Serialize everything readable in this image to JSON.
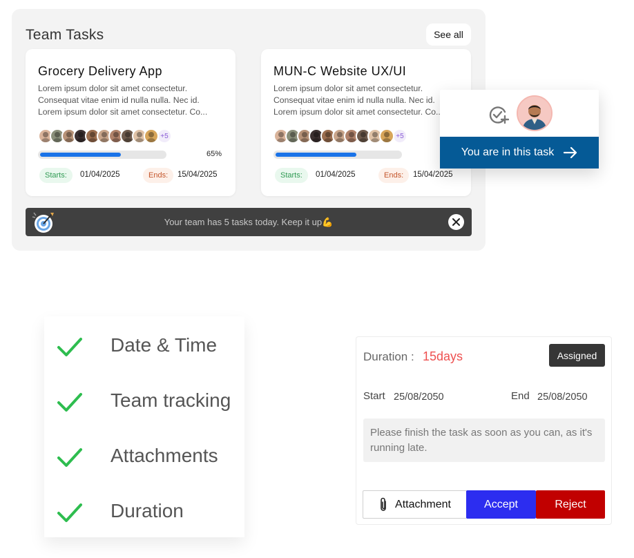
{
  "team_tasks": {
    "title": "Team Tasks",
    "see_all_label": "See all",
    "cards": [
      {
        "title": "Grocery Delivery App",
        "description": [
          "Lorem ipsum dolor sit amet consectetur.",
          "Consequat vitae enim id nulla nulla. Nec id.",
          "Lorem ipsum dolor sit amet consectetur. Co..."
        ],
        "members_extra": "+5",
        "progress_percent": 65,
        "progress_label": "65%",
        "starts_label": "Starts:",
        "start_date": "01/04/2025",
        "ends_label": "Ends:",
        "end_date": "15/04/2025"
      },
      {
        "title": "MUN-C Website UX/UI",
        "description": [
          "Lorem ipsum dolor sit amet consectetur.",
          "Consequat vitae enim id nulla nulla. Nec id.",
          "Lorem ipsum dolor sit amet consectetur. Co..."
        ],
        "members_extra": "+5",
        "progress_percent": 65,
        "starts_label": "Starts:",
        "start_date": "01/04/2025",
        "ends_label": "Ends:",
        "end_date": "15/04/2025"
      }
    ],
    "banner_text": "Your team has 5 tasks today. Keep it up💪"
  },
  "popup": {
    "button_label": "You are in this task"
  },
  "features": {
    "items": [
      "Date & Time",
      "Team tracking",
      "Attachments",
      "Duration"
    ]
  },
  "duration_card": {
    "duration_label": "Duration :",
    "duration_value": "15days",
    "badge": "Assigned",
    "start_label": "Start",
    "start_value": "25/08/2050",
    "end_label": "End",
    "end_value": "25/08/2050",
    "note": "Please finish the task as soon as you can, as it's running late.",
    "attachment_label": "Attachment",
    "accept_label": "Accept",
    "reject_label": "Reject"
  },
  "colors": {
    "progress": "#1a73e8",
    "popup_button": "#055a96",
    "check": "#2ebd4f",
    "duration_value": "#ee5050",
    "accept": "#2c2df0",
    "reject": "#c10000"
  },
  "avatar_colors": [
    "#d9b39a",
    "#8a8f7a",
    "#b79277",
    "#3b3030",
    "#9a6d4e",
    "#c9a58a",
    "#b0826a",
    "#6e5a4c",
    "#e0c2a6",
    "#d7a55a"
  ]
}
